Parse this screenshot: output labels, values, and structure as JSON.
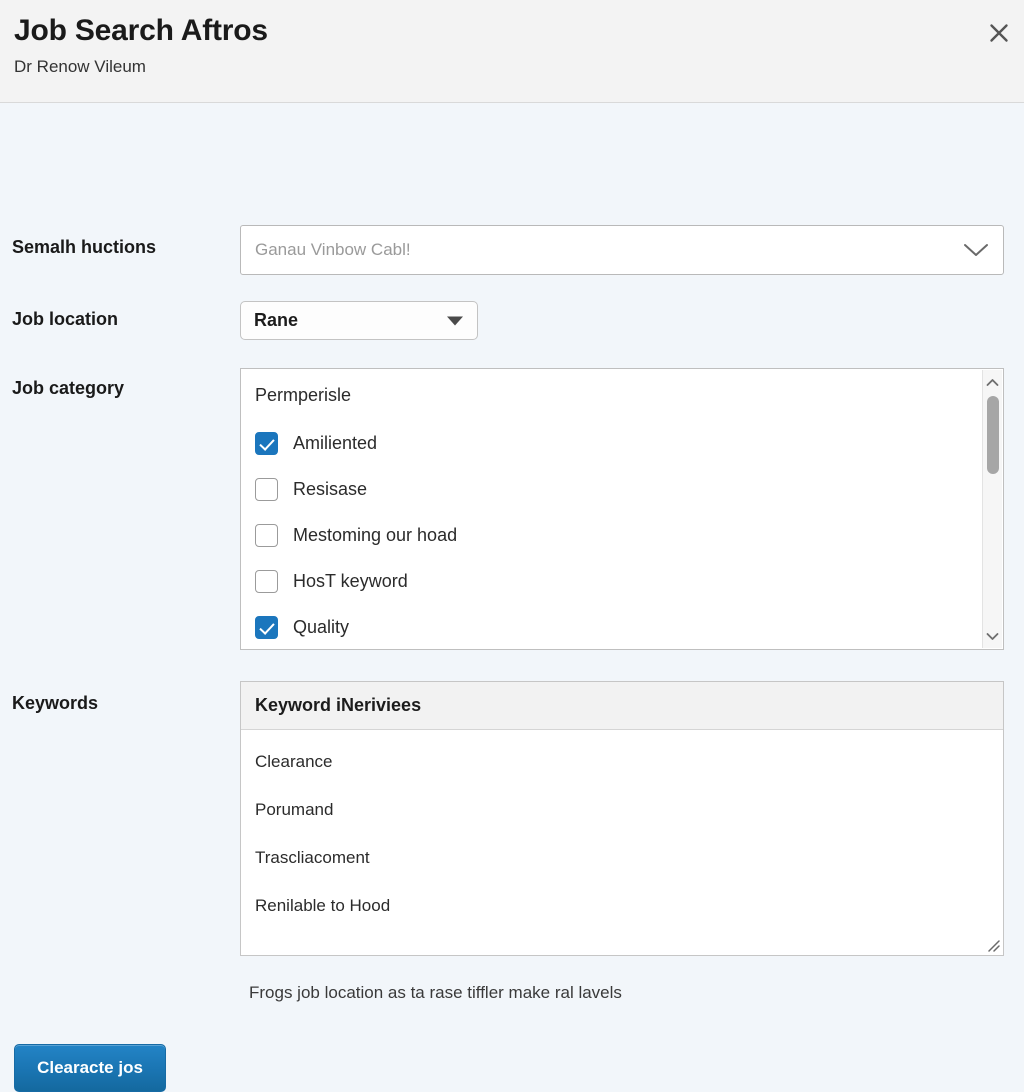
{
  "header": {
    "title": "Job Search Aftros",
    "subtitle": "Dr Renow Vileum",
    "close_label": "×"
  },
  "form": {
    "search": {
      "label": "Semalh huctions",
      "placeholder": "Ganau Vinbow Cabl!",
      "value": ""
    },
    "location": {
      "label": "Job location",
      "value": "Rane"
    },
    "category": {
      "label": "Job category",
      "group_label": "Permperisle",
      "options": [
        {
          "label": "Amiliented",
          "checked": true
        },
        {
          "label": "Resisase",
          "checked": false
        },
        {
          "label": "Mestoming our hoad",
          "checked": false
        },
        {
          "label": "HosT keyword",
          "checked": false
        },
        {
          "label": "Quality",
          "checked": true
        }
      ]
    },
    "keywords": {
      "label": "Keywords",
      "panel_header": "Keyword iNeriviees",
      "items": [
        "Clearance",
        "Porumand",
        "Trascliacoment",
        "Renilable to Hood"
      ]
    },
    "help_text": "Frogs job location as ta rase tiffler make ral lavels",
    "submit_label": "Clearacte jos"
  },
  "colors": {
    "accent": "#1b76bd",
    "button_blue": "#1b76b4",
    "page_background": "#f2f6fa",
    "header_background": "#f3f3f3"
  },
  "icons": {
    "close": "close-icon",
    "chevron_down": "chevron-down-icon",
    "select_arrow": "triangle-down-icon",
    "scroll_up": "scroll-up-arrow-icon",
    "scroll_down": "scroll-down-arrow-icon",
    "resize": "resize-grip-icon"
  }
}
